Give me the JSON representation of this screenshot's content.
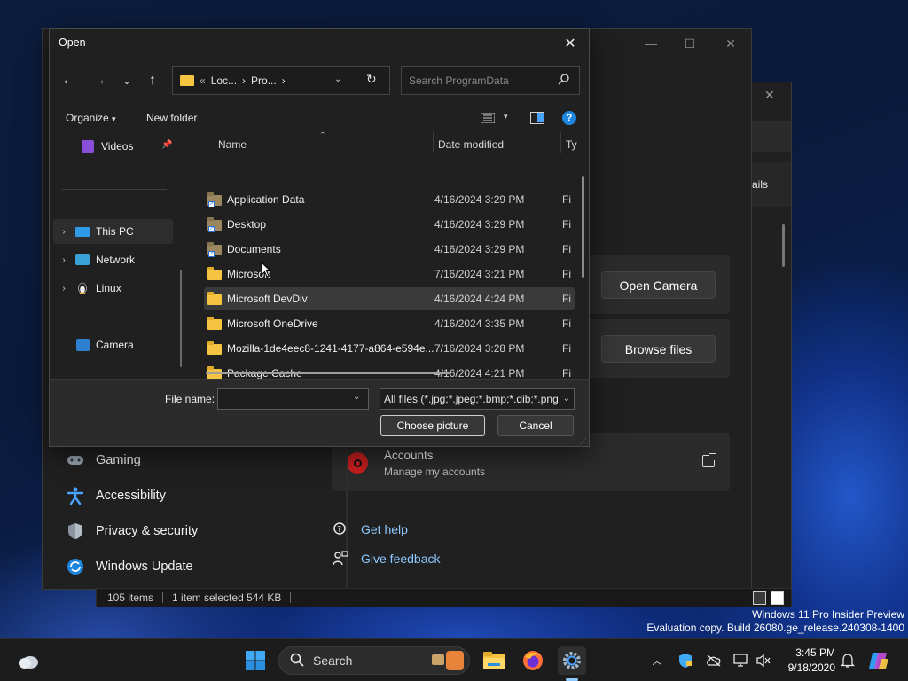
{
  "dialog": {
    "title": "Open",
    "breadcrumb": {
      "prefix": "«",
      "seg1": "Loc...",
      "seg2": "Pro...",
      "sep": "›"
    },
    "search_placeholder": "Search ProgramData",
    "toolbar": {
      "organize": "Organize",
      "new_folder": "New folder"
    },
    "left_pane": {
      "items": [
        {
          "label": "Videos"
        },
        {
          "label": "This PC"
        },
        {
          "label": "Network"
        },
        {
          "label": "Linux"
        },
        {
          "label": "Camera"
        }
      ]
    },
    "columns": {
      "name": "Name",
      "date": "Date modified",
      "type": "Ty"
    },
    "files": [
      {
        "name": "Application Data",
        "date": "4/16/2024 3:29 PM",
        "type": "Fi"
      },
      {
        "name": "Desktop",
        "date": "4/16/2024 3:29 PM",
        "type": "Fi"
      },
      {
        "name": "Documents",
        "date": "4/16/2024 3:29 PM",
        "type": "Fi"
      },
      {
        "name": "Microsoft",
        "date": "7/16/2024 3:21 PM",
        "type": "Fi"
      },
      {
        "name": "Microsoft DevDiv",
        "date": "4/16/2024 4:24 PM",
        "type": "Fi"
      },
      {
        "name": "Microsoft OneDrive",
        "date": "4/16/2024 3:35 PM",
        "type": "Fi"
      },
      {
        "name": "Mozilla-1de4eec8-1241-4177-a864-e594e...",
        "date": "7/16/2024 3:28 PM",
        "type": "Fi"
      },
      {
        "name": "Package Cache",
        "date": "4/16/2024 4:21 PM",
        "type": "Fi"
      }
    ],
    "file_name_label": "File name:",
    "file_name_value": "",
    "filter_value": "All files (*.jpg;*.jpeg;*.bmp;*.dib;*.png",
    "choose_button": "Choose picture",
    "cancel_button": "Cancel"
  },
  "settings": {
    "partial_label": "ails",
    "open_camera": "Open Camera",
    "browse_files": "Browse files",
    "accounts_title": "Accounts",
    "accounts_sub": "Manage my accounts",
    "nav": [
      {
        "label": "Gaming"
      },
      {
        "label": "Accessibility"
      },
      {
        "label": "Privacy & security"
      },
      {
        "label": "Windows Update"
      }
    ],
    "get_help": "Get help",
    "give_feedback": "Give feedback"
  },
  "statusbar": {
    "items": "105 items",
    "selection": "1 item selected  544 KB"
  },
  "watermark": {
    "line1": "Windows 11 Pro Insider Preview",
    "line2": "Evaluation copy. Build 26080.ge_release.240308-1400"
  },
  "taskbar": {
    "search_label": "Search",
    "time": "3:45 PM",
    "date": "9/18/2020"
  },
  "colors": {
    "accent": "#8cc8ff",
    "folder": "#f5c542",
    "dialog_bg": "#202020"
  }
}
